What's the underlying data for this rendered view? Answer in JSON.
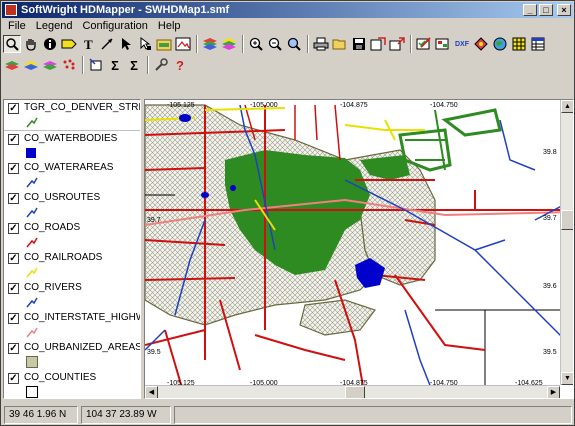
{
  "window": {
    "title": "SoftWright HDMapper - SWHDMap1.smf",
    "controls": {
      "minimize": "_",
      "maximize": "□",
      "close": "×"
    }
  },
  "menu": [
    "File",
    "Legend",
    "Configuration",
    "Help"
  ],
  "toolbar_row1": [
    "zoom-tool-icon",
    "pan-hand-icon",
    "info-icon",
    "label-icon",
    "text-tool-icon",
    "line-tool-icon",
    "arrow-select-icon",
    "node-select-icon",
    "layer-folder-icon",
    "map-image-icon",
    "stack-layers-icon",
    "stack-layers-2-icon",
    "zoom-in-icon",
    "zoom-out-icon",
    "zoom-extent-icon",
    "print-icon",
    "open-folder-icon",
    "save-icon",
    "export-icon",
    "new-window-icon",
    "edit-layer-icon",
    "layer-properties-icon",
    "dxf-import-icon",
    "shape-icon",
    "globe-icon",
    "grid-icon",
    "table-icon"
  ],
  "toolbar_row1_dxf_text": "DXF",
  "toolbar_row2": [
    "layer-red-icon",
    "layer-add-icon",
    "layer-remove-icon",
    "points-icon",
    "goto-icon",
    "sum-icon",
    "sum-2-icon",
    "settings-icon",
    "help-icon"
  ],
  "toolbar_row2_text": {
    "sum": "Σ",
    "sum2": "Σ",
    "help": "?"
  },
  "legend": [
    {
      "name": "TGR_CO_DENVER_STREETS",
      "checked": true,
      "swatch": "line",
      "color": "#2e8b22"
    },
    {
      "name": "CO_WATERBODIES",
      "checked": true,
      "swatch": "fill",
      "color": "#0000cc"
    },
    {
      "name": "CO_WATERAREAS",
      "checked": true,
      "swatch": "line",
      "color": "#2040c0"
    },
    {
      "name": "CO_USROUTES",
      "checked": true,
      "swatch": "line",
      "color": "#2040c0"
    },
    {
      "name": "CO_ROADS",
      "checked": true,
      "swatch": "line",
      "color": "#d01010"
    },
    {
      "name": "CO_RAILROADS",
      "checked": true,
      "swatch": "line",
      "color": "#e8e000"
    },
    {
      "name": "CO_RIVERS",
      "checked": true,
      "swatch": "line",
      "color": "#2040c0"
    },
    {
      "name": "CO_INTERSTATE_HIGHWAY",
      "checked": true,
      "swatch": "line",
      "color": "#f08080"
    },
    {
      "name": "CO_URBANIZED_AREAS",
      "checked": true,
      "swatch": "fill",
      "color": "#8b8b6a"
    },
    {
      "name": "CO_COUNTIES",
      "checked": true,
      "swatch": "box",
      "color": "#000000"
    }
  ],
  "map": {
    "top_labels": [
      "-105.125",
      "-105.000",
      "-104.875",
      "-104.750"
    ],
    "bottom_labels": [
      "-105.125",
      "-105.000",
      "-104.875",
      "-104.750",
      "-104.625"
    ],
    "left_labels": [
      "39.7",
      "39.5"
    ],
    "right_labels": [
      "39.8",
      "39.7",
      "39.6",
      "39.5"
    ],
    "colors": {
      "streets": "#2e8b22",
      "roads": "#d01010",
      "interstate": "#f08080",
      "rivers": "#2040c0",
      "railroads": "#e8e000",
      "waterbodies": "#0000cc",
      "urbanized": "#8b8b6a",
      "counties": "#000000"
    }
  },
  "status": {
    "latitude": "39 46 1.96 N",
    "longitude": "104 37 23.89 W"
  }
}
